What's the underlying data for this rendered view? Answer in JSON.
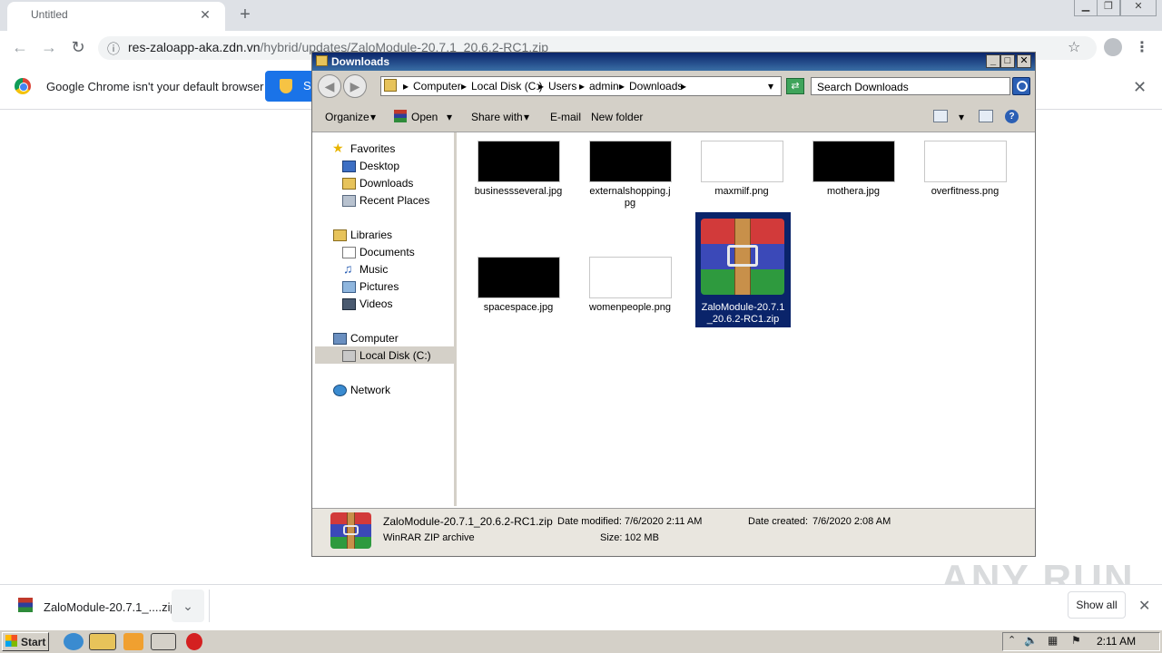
{
  "browser": {
    "tab_title": "Untitled",
    "url_host": "res-zaloapp-aka.zdn.vn",
    "url_path": "/hybrid/updates/ZaloModule-20.7.1_20.6.2-RC1.zip",
    "infobar_text": "Google Chrome isn't your default browser",
    "set_default_label": "S"
  },
  "explorer": {
    "title": "Downloads",
    "breadcrumb": [
      "Computer",
      "Local Disk (C:)",
      "Users",
      "admin",
      "Downloads"
    ],
    "search_placeholder": "Search Downloads",
    "commands": {
      "organize": "Organize",
      "open": "Open",
      "share_with": "Share with",
      "email": "E-mail",
      "new_folder": "New folder"
    },
    "nav": {
      "favorites": "Favorites",
      "desktop": "Desktop",
      "downloads": "Downloads",
      "recent": "Recent Places",
      "libraries": "Libraries",
      "documents": "Documents",
      "music": "Music",
      "pictures": "Pictures",
      "videos": "Videos",
      "computer": "Computer",
      "local_disk": "Local Disk (C:)",
      "network": "Network"
    },
    "files": [
      {
        "name": "businessseveral.jpg",
        "thumb": "black"
      },
      {
        "name": "externalshopping.jpg",
        "thumb": "black"
      },
      {
        "name": "maxmilf.png",
        "thumb": "white"
      },
      {
        "name": "mothera.jpg",
        "thumb": "black"
      },
      {
        "name": "overfitness.png",
        "thumb": "white"
      },
      {
        "name": "spacespace.jpg",
        "thumb": "black"
      },
      {
        "name": "womenpeople.png",
        "thumb": "white"
      },
      {
        "name": "ZaloModule-20.7.1_20.6.2-RC1.zip",
        "thumb": "winrar",
        "selected": true
      }
    ],
    "file_labels": {
      "f0": "businessseveral.jpg",
      "f1a": "externalshopping.j",
      "f1b": "pg",
      "f2": "maxmilf.png",
      "f3": "mothera.jpg",
      "f4": "overfitness.png",
      "f5": "spacespace.jpg",
      "f6": "womenpeople.png",
      "f7a": "ZaloModule-20.7.1",
      "f7b": "_20.6.2-RC1.zip"
    },
    "details": {
      "filename": "ZaloModule-20.7.1_20.6.2-RC1.zip",
      "type": "WinRAR ZIP archive",
      "date_modified_label": "Date modified:",
      "date_modified": "7/6/2020 2:11 AM",
      "date_created_label": "Date created:",
      "date_created": "7/6/2020 2:08 AM",
      "size_label": "Size:",
      "size": "102 MB"
    }
  },
  "download_shelf": {
    "item_name": "ZaloModule-20.7.1_....zip",
    "show_all": "Show all"
  },
  "watermark": "ANY RUN",
  "taskbar": {
    "start": "Start",
    "clock": "2:11 AM"
  }
}
